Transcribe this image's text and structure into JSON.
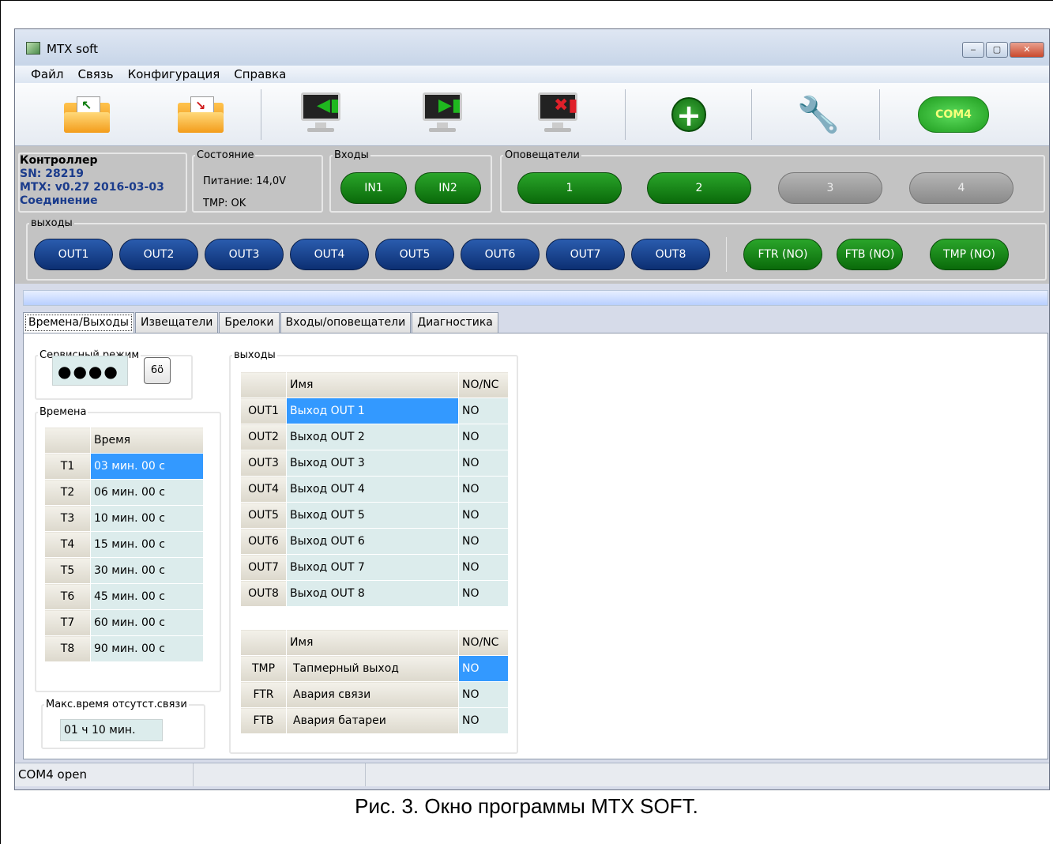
{
  "window": {
    "title": "MTX soft",
    "minimize": "‒",
    "maximize": "▢",
    "close": "✕"
  },
  "menu": [
    {
      "label": "Файл"
    },
    {
      "label": "Связь"
    },
    {
      "label": "Конфигурация"
    },
    {
      "label": "Справка"
    }
  ],
  "toolbar": {
    "com_label": "COM4"
  },
  "controller": {
    "legend": "Контроллер",
    "sn": "SN: 28219",
    "version": "MTX: v0.27 2016-03-03",
    "connection": "Соединение"
  },
  "state": {
    "legend": "Состояние",
    "power": "Питание: 14,0V",
    "tmp": "TMP: OK"
  },
  "inputs": {
    "legend": "Входы",
    "in1": "IN1",
    "in2": "IN2"
  },
  "sounders": {
    "legend": "Оповещатели",
    "s1": "1",
    "s2": "2",
    "s3": "3",
    "s4": "4"
  },
  "outputs_panel": {
    "legend": "выходы",
    "out1": "OUT1",
    "out2": "OUT2",
    "out3": "OUT3",
    "out4": "OUT4",
    "out5": "OUT5",
    "out6": "OUT6",
    "out7": "OUT7",
    "out8": "OUT8",
    "ftr": "FTR (NO)",
    "ftb": "FTB (NO)",
    "tmp": "TMP (NO)"
  },
  "tabs": [
    "Времена/Выходы",
    "Извещатели",
    "Брелоки",
    "Входы/оповещатели",
    "Диагностика"
  ],
  "service": {
    "legend": "Сервисный режим",
    "password": "●●●●",
    "eye": "6ö"
  },
  "times": {
    "legend": "Времена",
    "header": "Время",
    "rows": [
      {
        "id": "T1",
        "value": "03 мин. 00 с"
      },
      {
        "id": "T2",
        "value": "06 мин. 00 с"
      },
      {
        "id": "T3",
        "value": "10 мин. 00 с"
      },
      {
        "id": "T4",
        "value": "15 мин. 00 с"
      },
      {
        "id": "T5",
        "value": "30 мин. 00 с"
      },
      {
        "id": "T6",
        "value": "45 мин. 00 с"
      },
      {
        "id": "T7",
        "value": "60 мин. 00 с"
      },
      {
        "id": "T8",
        "value": "90 мин. 00 с"
      }
    ]
  },
  "maxtime": {
    "legend": "Макс.время отсутст.связи",
    "value": "01 ч 10 мин."
  },
  "outputs_table": {
    "legend": "выходы",
    "col_name": "Имя",
    "col_nonc": "NO/NC",
    "rows": [
      {
        "id": "OUT1",
        "name": "Выход OUT 1",
        "nonc": "NO"
      },
      {
        "id": "OUT2",
        "name": "Выход OUT 2",
        "nonc": "NO"
      },
      {
        "id": "OUT3",
        "name": "Выход OUT 3",
        "nonc": "NO"
      },
      {
        "id": "OUT4",
        "name": "Выход OUT 4",
        "nonc": "NO"
      },
      {
        "id": "OUT5",
        "name": "Выход OUT 5",
        "nonc": "NO"
      },
      {
        "id": "OUT6",
        "name": "Выход OUT 6",
        "nonc": "NO"
      },
      {
        "id": "OUT7",
        "name": "Выход OUT 7",
        "nonc": "NO"
      },
      {
        "id": "OUT8",
        "name": "Выход OUT 8",
        "nonc": "NO"
      }
    ]
  },
  "system_outputs": {
    "col_name": "Имя",
    "col_nonc": "NO/NC",
    "rows": [
      {
        "id": "TMP",
        "name": "Тапмерный выход",
        "nonc": "NO"
      },
      {
        "id": "FTR",
        "name": "Авария связи",
        "nonc": "NO"
      },
      {
        "id": "FTB",
        "name": "Авария батареи",
        "nonc": "NO"
      }
    ]
  },
  "statusbar": {
    "text": "COM4 open"
  },
  "caption": "Рис. 3. Окно программы MTX SOFT."
}
